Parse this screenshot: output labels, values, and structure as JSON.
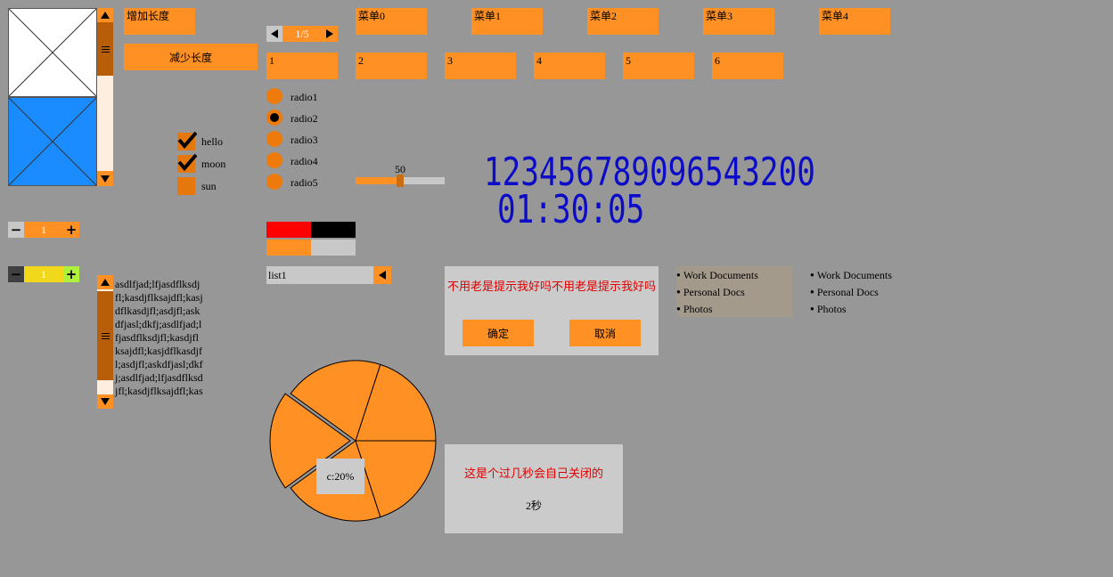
{
  "colors": {
    "background": "#979797",
    "accent": "#ff9024",
    "lcd": "#0c0cc8",
    "warning_text": "#e00000"
  },
  "buttons": {
    "increase": "增加长度",
    "decrease": "减少长度"
  },
  "pager": {
    "value": "1/5"
  },
  "menu": [
    "菜单0",
    "菜单1",
    "菜单2",
    "菜单3",
    "菜单4"
  ],
  "tabs": [
    "1",
    "2",
    "3",
    "4",
    "5",
    "6"
  ],
  "radios": {
    "labels": [
      "radio1",
      "radio2",
      "radio3",
      "radio4",
      "radio5"
    ],
    "selected_index": 1
  },
  "checkboxes": [
    {
      "label": "hello",
      "checked": true
    },
    {
      "label": "moon",
      "checked": true
    },
    {
      "label": "sun",
      "checked": false
    }
  ],
  "slider": {
    "value": "50",
    "fraction": 0.5
  },
  "lcd": {
    "number": "123456789096543200",
    "time": "01:30:05"
  },
  "steppers": [
    {
      "value": "1"
    },
    {
      "value": "1"
    }
  ],
  "progress_fraction": 0.5,
  "text_area": {
    "lines": [
      "asdlfjad;lfjasdflksdj",
      "fl;kasdjflksajdfl;kasj",
      "dflkasdjfl;asdjfl;ask",
      "dfjasl;dkfj;asdlfjad;l",
      "fjasdflksdjfl;kasdjfl",
      "ksajdfl;kasjdflkasdjf",
      "l;asdjfl;askdfjasl;dkf",
      "j;asdlfjad;lfjasdflksd",
      "jfl;kasdjflksajdfl;kas"
    ]
  },
  "dropdown": {
    "value": "list1"
  },
  "dialog": {
    "message": "不用老是提示我好吗不用老是提示我好吗",
    "ok": "确定",
    "cancel": "取消"
  },
  "tree_lists": [
    [
      "Work Documents",
      "Personal Docs",
      "Photos"
    ],
    [
      "Work Documents",
      "Personal Docs",
      "Photos"
    ]
  ],
  "pie": {
    "slices": [
      20,
      20,
      20,
      20,
      20
    ],
    "label": "c:20%"
  },
  "toast": {
    "message": "这是个过几秒会自己关闭的",
    "countdown": "2秒"
  },
  "icons": [
    "image-placeholder-icon",
    "arrow-up-icon",
    "arrow-down-icon",
    "arrow-left-icon",
    "arrow-right-icon",
    "grip-icon",
    "checkmark-icon",
    "minus-icon",
    "plus-icon"
  ]
}
